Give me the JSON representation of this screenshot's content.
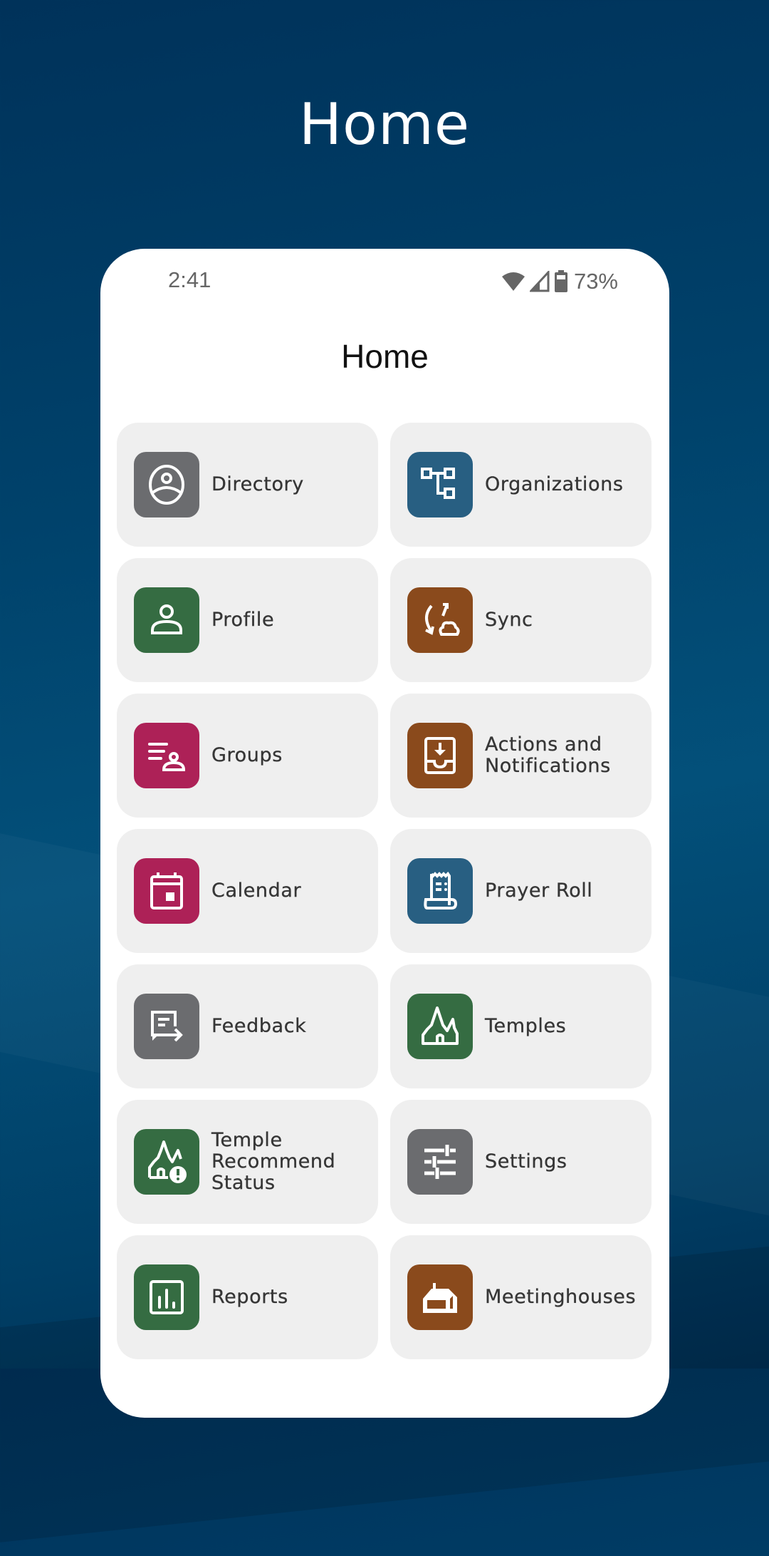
{
  "hero": {
    "title": "Home"
  },
  "status_bar": {
    "time": "2:41",
    "icons": [
      "wifi-icon",
      "cell-signal-icon",
      "battery-icon"
    ],
    "battery_percent": "73%"
  },
  "app_header": {
    "title": "Home"
  },
  "colors": {
    "gray": "#6b6c6f",
    "blue": "#285f82",
    "green": "#356c42",
    "brown": "#8a4a1c",
    "magenta": "#ad2157",
    "tile_bg": "#efefef"
  },
  "tiles": [
    {
      "label": "Directory",
      "icon": "directory-icon",
      "color": "#6b6c6f"
    },
    {
      "label": "Organizations",
      "icon": "organizations-icon",
      "color": "#285f82"
    },
    {
      "label": "Profile",
      "icon": "profile-icon",
      "color": "#356c42"
    },
    {
      "label": "Sync",
      "icon": "sync-icon",
      "color": "#8a4a1c"
    },
    {
      "label": "Groups",
      "icon": "groups-icon",
      "color": "#ad2157"
    },
    {
      "label": "Actions and\nNotifications",
      "icon": "inbox-download-icon",
      "color": "#8a4a1c"
    },
    {
      "label": "Calendar",
      "icon": "calendar-icon",
      "color": "#ad2157"
    },
    {
      "label": "Prayer Roll",
      "icon": "prayer-roll-icon",
      "color": "#285f82"
    },
    {
      "label": "Feedback",
      "icon": "feedback-icon",
      "color": "#6b6c6f"
    },
    {
      "label": "Temples",
      "icon": "temple-icon",
      "color": "#356c42"
    },
    {
      "label": "Temple\nRecommend\nStatus",
      "icon": "temple-alert-icon",
      "color": "#356c42"
    },
    {
      "label": "Settings",
      "icon": "sliders-icon",
      "color": "#6b6c6f"
    },
    {
      "label": "Reports",
      "icon": "bar-chart-icon",
      "color": "#356c42"
    },
    {
      "label": "Meetinghouses",
      "icon": "meetinghouse-icon",
      "color": "#8a4a1c"
    }
  ]
}
